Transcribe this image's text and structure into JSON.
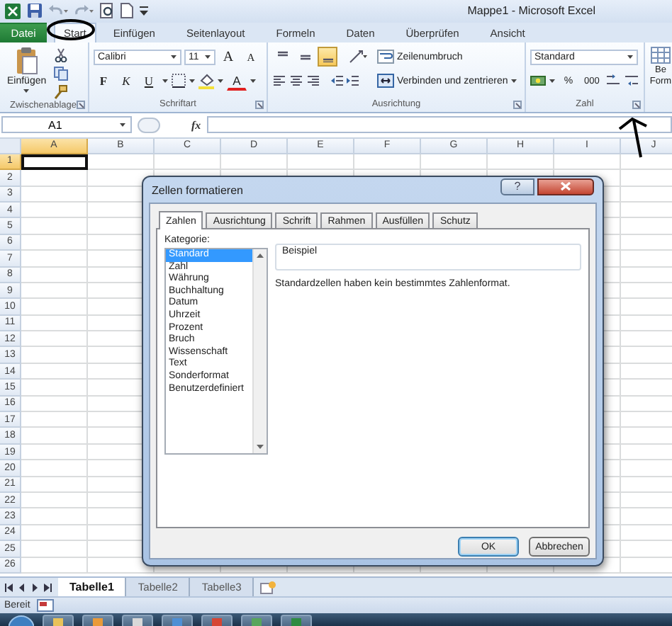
{
  "title_bar": {
    "title": "Mappe1 - Microsoft Excel"
  },
  "ribbon_tabs": [
    {
      "label": "Datei",
      "kind": "file",
      "selected": false
    },
    {
      "label": "Start",
      "kind": "tab",
      "selected": true
    },
    {
      "label": "Einfügen",
      "kind": "tab",
      "selected": false
    },
    {
      "label": "Seitenlayout",
      "kind": "tab",
      "selected": false
    },
    {
      "label": "Formeln",
      "kind": "tab",
      "selected": false
    },
    {
      "label": "Daten",
      "kind": "tab",
      "selected": false
    },
    {
      "label": "Überprüfen",
      "kind": "tab",
      "selected": false
    },
    {
      "label": "Ansicht",
      "kind": "tab",
      "selected": false
    }
  ],
  "ribbon": {
    "clipboard": {
      "label": "Zwischenablage",
      "paste": "Einfügen"
    },
    "font": {
      "label": "Schriftart",
      "font_name": "Calibri",
      "font_size": "11",
      "grow": "A",
      "shrink": "A",
      "styles": [
        "F",
        "K",
        "U"
      ],
      "color_letter": "A"
    },
    "alignment": {
      "label": "Ausrichtung",
      "vertical": [
        {
          "selected": false
        },
        {
          "selected": false
        },
        {
          "selected": true
        }
      ],
      "wrap": "Zeilenumbruch",
      "merge": "Verbinden und zentrieren"
    },
    "number": {
      "label": "Zahl",
      "format": "Standard",
      "percent": "%",
      "thousands": "000"
    },
    "styles": {
      "line_1": "Be",
      "line_2": "Form"
    }
  },
  "formula_bar": {
    "cell_ref": "A1",
    "fx": "fx"
  },
  "sheet": {
    "columns": [
      {
        "label": "A",
        "selected": true
      },
      {
        "label": "B",
        "selected": false
      },
      {
        "label": "C",
        "selected": false
      },
      {
        "label": "D",
        "selected": false
      },
      {
        "label": "E",
        "selected": false
      },
      {
        "label": "F",
        "selected": false
      },
      {
        "label": "G",
        "selected": false
      },
      {
        "label": "H",
        "selected": false
      },
      {
        "label": "I",
        "selected": false
      },
      {
        "label": "J",
        "selected": false
      }
    ],
    "rows": [
      {
        "label": "1",
        "selected": true
      },
      {
        "label": "2",
        "selected": false
      },
      {
        "label": "3",
        "selected": false
      },
      {
        "label": "4",
        "selected": false
      },
      {
        "label": "5",
        "selected": false
      },
      {
        "label": "6",
        "selected": false
      },
      {
        "label": "7",
        "selected": false
      },
      {
        "label": "8",
        "selected": false
      },
      {
        "label": "9",
        "selected": false
      },
      {
        "label": "10",
        "selected": false
      },
      {
        "label": "11",
        "selected": false
      },
      {
        "label": "12",
        "selected": false
      },
      {
        "label": "13",
        "selected": false
      },
      {
        "label": "14",
        "selected": false
      },
      {
        "label": "15",
        "selected": false
      },
      {
        "label": "16",
        "selected": false
      },
      {
        "label": "17",
        "selected": false
      },
      {
        "label": "18",
        "selected": false
      },
      {
        "label": "19",
        "selected": false
      },
      {
        "label": "20",
        "selected": false
      },
      {
        "label": "21",
        "selected": false
      },
      {
        "label": "22",
        "selected": false
      },
      {
        "label": "23",
        "selected": false
      },
      {
        "label": "24",
        "selected": false
      },
      {
        "label": "25",
        "selected": false
      },
      {
        "label": "26",
        "selected": false
      }
    ]
  },
  "dialog": {
    "title": "Zellen formatieren",
    "help": "?",
    "tabs": [
      {
        "label": "Zahlen",
        "selected": true
      },
      {
        "label": "Ausrichtung",
        "selected": false
      },
      {
        "label": "Schrift",
        "selected": false
      },
      {
        "label": "Rahmen",
        "selected": false
      },
      {
        "label": "Ausfüllen",
        "selected": false
      },
      {
        "label": "Schutz",
        "selected": false
      }
    ],
    "category_label": "Kategorie:",
    "categories": [
      {
        "label": "Standard",
        "selected": true
      },
      {
        "label": "Zahl",
        "selected": false
      },
      {
        "label": "Währung",
        "selected": false
      },
      {
        "label": "Buchhaltung",
        "selected": false
      },
      {
        "label": "Datum",
        "selected": false
      },
      {
        "label": "Uhrzeit",
        "selected": false
      },
      {
        "label": "Prozent",
        "selected": false
      },
      {
        "label": "Bruch",
        "selected": false
      },
      {
        "label": "Wissenschaft",
        "selected": false
      },
      {
        "label": "Text",
        "selected": false
      },
      {
        "label": "Sonderformat",
        "selected": false
      },
      {
        "label": "Benutzerdefiniert",
        "selected": false
      }
    ],
    "sample_label": "Beispiel",
    "description": "Standardzellen haben kein bestimmtes Zahlenformat.",
    "buttons": [
      {
        "label": "OK",
        "default": true
      },
      {
        "label": "Abbrechen",
        "default": false
      }
    ]
  },
  "sheet_tabs": [
    {
      "label": "Tabelle1",
      "selected": true
    },
    {
      "label": "Tabelle2",
      "selected": false
    },
    {
      "label": "Tabelle3",
      "selected": false
    }
  ],
  "status_bar": {
    "status": "Bereit"
  }
}
